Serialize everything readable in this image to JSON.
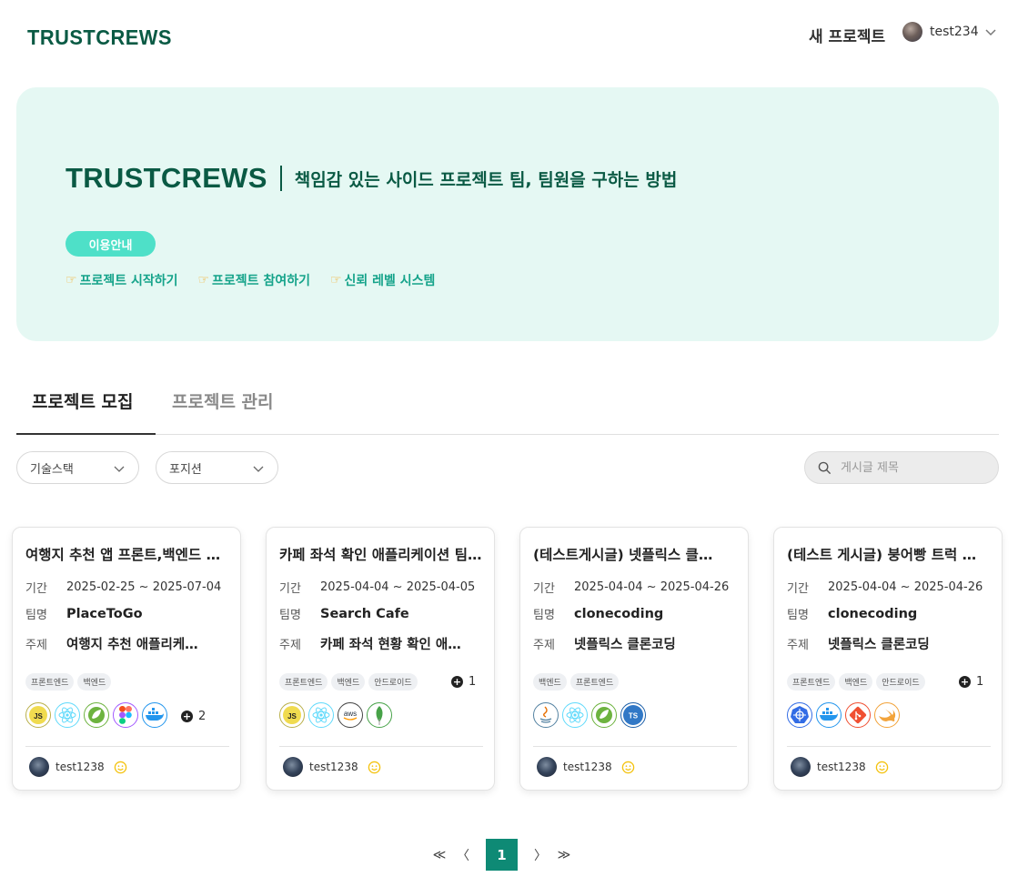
{
  "header": {
    "logo": "TRUSTCREWS",
    "new_project": "새 프로젝트",
    "user_name": "test234"
  },
  "banner": {
    "brand": "TRUSTCREWS",
    "subtitle": "책임감 있는 사이드 프로젝트 팀, 팀원을 구하는 방법",
    "guide_label": "이용안내",
    "links": [
      "프로젝트 시작하기",
      "프로젝트 참여하기",
      "신뢰 레벨 시스템"
    ],
    "link_icon": "pointing-hand-icon"
  },
  "tabs": {
    "active": "프로젝트 모집",
    "inactive": "프로젝트 관리"
  },
  "filters": {
    "tech_stack": "기술스택",
    "position": "포지션"
  },
  "search": {
    "placeholder": "게시글 제목"
  },
  "cards": [
    {
      "title": "여행지 추천 앱 프론트,백엔드 개발자 모집",
      "period_label": "기간",
      "period": "2025-02-25 ~ 2025-07-04",
      "team_label": "팀명",
      "team": "PlaceToGo",
      "topic_label": "주제",
      "topic": "여행지 추천 애플리케이션",
      "tags": [
        "프론트엔드",
        "백엔드"
      ],
      "more_tags": "",
      "stack": [
        "javascript-icon",
        "react-icon",
        "spring-icon",
        "figma-icon",
        "docker-icon"
      ],
      "more_stack": "2",
      "author": "test1238"
    },
    {
      "title": "카페 좌석 확인 애플리케이션 팀원 모집",
      "period_label": "기간",
      "period": "2025-04-04 ~ 2025-04-05",
      "team_label": "팀명",
      "team": "Search Cafe",
      "topic_label": "주제",
      "topic": "카페 좌석 현황 확인 애플리케이션",
      "tags": [
        "프론트엔드",
        "백엔드",
        "안드로이드"
      ],
      "more_tags": "1",
      "stack": [
        "javascript-icon",
        "react-icon",
        "aws-icon",
        "mongodb-icon"
      ],
      "more_stack": "",
      "author": "test1238"
    },
    {
      "title": "(테스트게시글) 넷플릭스 클론코딩",
      "period_label": "기간",
      "period": "2025-04-04 ~ 2025-04-26",
      "team_label": "팀명",
      "team": "clonecoding",
      "topic_label": "주제",
      "topic": "넷플릭스 클론코딩",
      "tags": [
        "백엔드",
        "프론트엔드"
      ],
      "more_tags": "",
      "stack": [
        "java-icon",
        "react-icon",
        "spring-icon",
        "typescript-icon"
      ],
      "more_stack": "",
      "author": "test1238"
    },
    {
      "title": "(테스트 게시글) 붕어빵 트럭 위치 서비스",
      "period_label": "기간",
      "period": "2025-04-04 ~ 2025-04-26",
      "team_label": "팀명",
      "team": "clonecoding",
      "topic_label": "주제",
      "topic": "넷플릭스 클론코딩",
      "tags": [
        "프론트엔드",
        "백엔드",
        "안드로이드"
      ],
      "more_tags": "1",
      "stack": [
        "kubernetes-icon",
        "docker-icon",
        "git-icon",
        "swift-icon"
      ],
      "more_stack": "",
      "author": "test1238"
    }
  ],
  "pagination": {
    "first": "≪",
    "prev": "〈",
    "current": "1",
    "next": "〉",
    "last": "≫"
  },
  "colors": {
    "brand": "#0a5a44",
    "banner_bg": "#e5f8f3",
    "pill": "#4ee0c8",
    "link": "#15a38a",
    "page_active": "#0e8a75"
  }
}
